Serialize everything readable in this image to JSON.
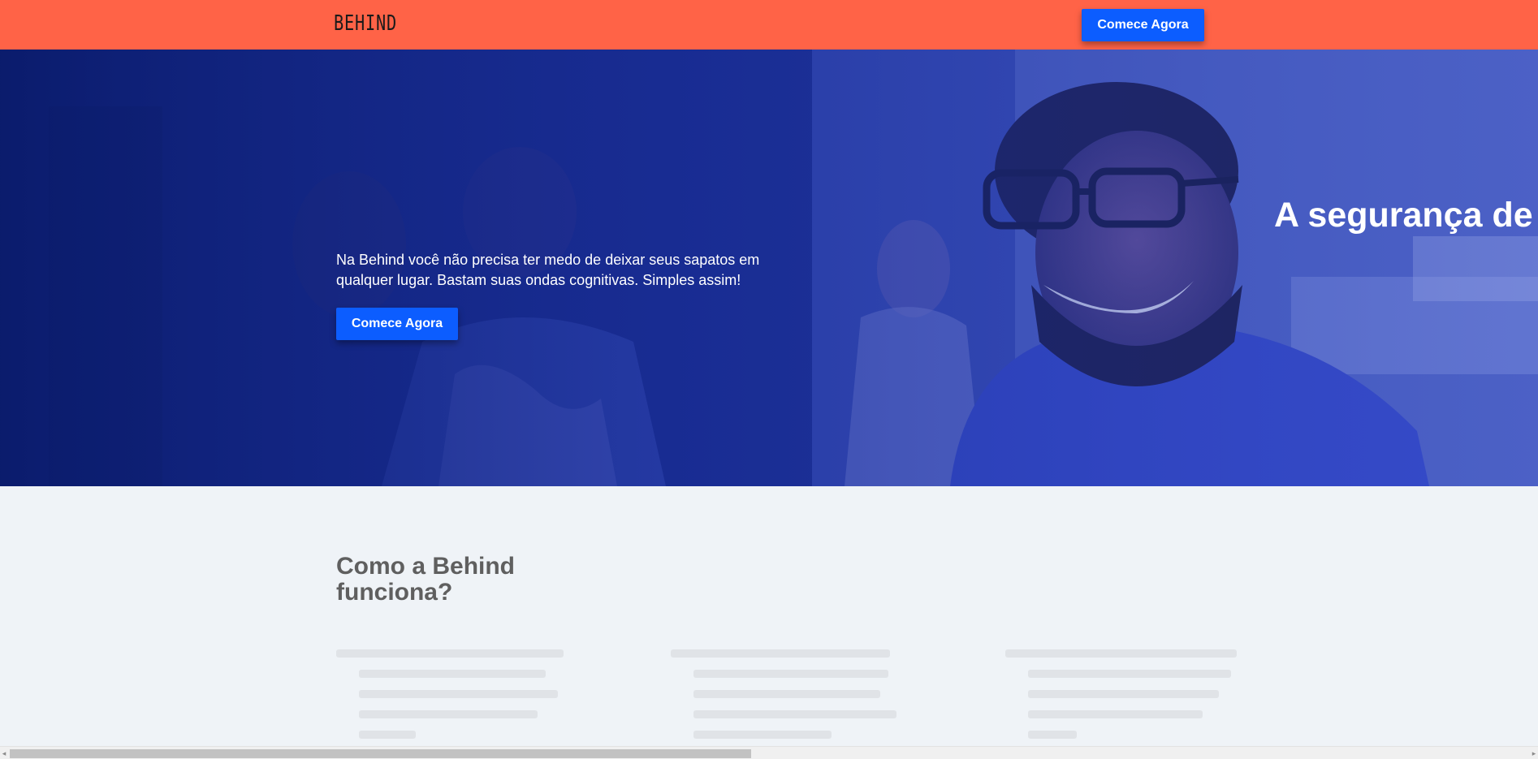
{
  "header": {
    "logo_text": "BEHIND",
    "cta_label": "Comece Agora"
  },
  "hero": {
    "title": "A segurança de s",
    "description": "Na Behind você não precisa ter medo de deixar seus sapatos em qualquer lugar. Bastam suas ondas cognitivas. Simples assim!",
    "cta_label": "Comece Agora",
    "image": "hero-smiling-man-office-photo"
  },
  "how_it_works": {
    "title": "Como a Behind funciona?"
  },
  "scrollbar": {
    "left_arrow_icon": "triangle-left-icon",
    "right_arrow_icon": "triangle-right-icon",
    "left_arrow": "◂",
    "right_arrow": "▸",
    "position_fraction": 0.49
  },
  "colors": {
    "header_bg": "#ff6347",
    "button_bg": "#0c5dff",
    "hero_overlay": "#1a2f9a",
    "section_bg": "#eff3f7",
    "section_title": "#5f5f5f"
  }
}
